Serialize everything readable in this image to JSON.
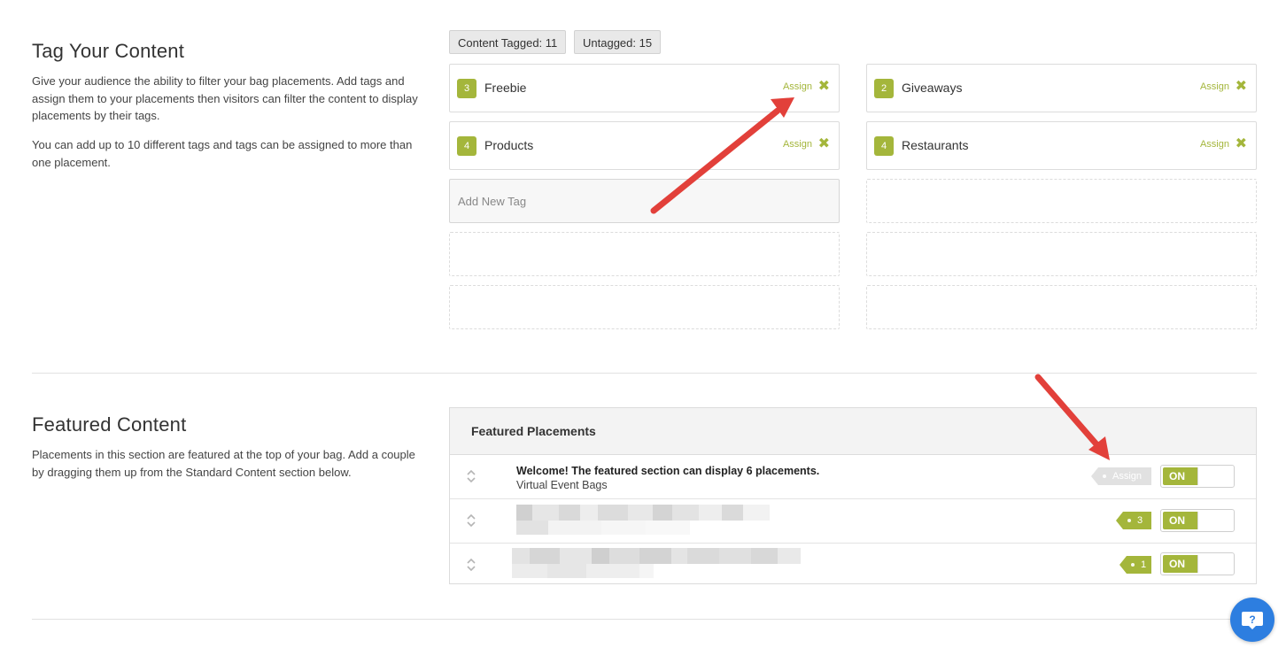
{
  "tag_section": {
    "title": "Tag Your Content",
    "paragraph1": "Give your audience the ability to filter your bag placements. Add tags and assign them to your placements then visitors can filter the content to display placements by their tags.",
    "paragraph2": "You can add up to 10 different tags and tags can be assigned to more than one placement.",
    "counters": {
      "tagged_label": "Content Tagged: 11",
      "untagged_label": "Untagged: 15"
    },
    "tags": [
      {
        "count": "3",
        "name": "Freebie",
        "assign_label": "Assign"
      },
      {
        "count": "2",
        "name": "Giveaways",
        "assign_label": "Assign"
      },
      {
        "count": "4",
        "name": "Products",
        "assign_label": "Assign"
      },
      {
        "count": "4",
        "name": "Restaurants",
        "assign_label": "Assign"
      }
    ],
    "add_tag_placeholder": "Add New Tag"
  },
  "featured_section": {
    "title": "Featured Content",
    "paragraph": "Placements in this section are featured at the top of your bag. Add a couple by dragging them up from the Standard Content section below.",
    "panel_title": "Featured Placements",
    "rows": [
      {
        "title": "Welcome! The featured section can display 6 placements.",
        "subtitle": "Virtual Event Bags",
        "tag_label": "Assign",
        "toggle_label": "ON"
      },
      {
        "title": "",
        "subtitle": "",
        "tag_label": "3",
        "toggle_label": "ON"
      },
      {
        "title": "",
        "subtitle": "",
        "tag_label": "1",
        "toggle_label": "ON"
      }
    ]
  },
  "colors": {
    "accent_green": "#a4b63b",
    "arrow_red": "#e2403a",
    "help_blue": "#2d7ee0"
  },
  "icons": {
    "remove": "x-icon",
    "drag": "drag-handle-icon",
    "help": "question-mark-icon"
  }
}
